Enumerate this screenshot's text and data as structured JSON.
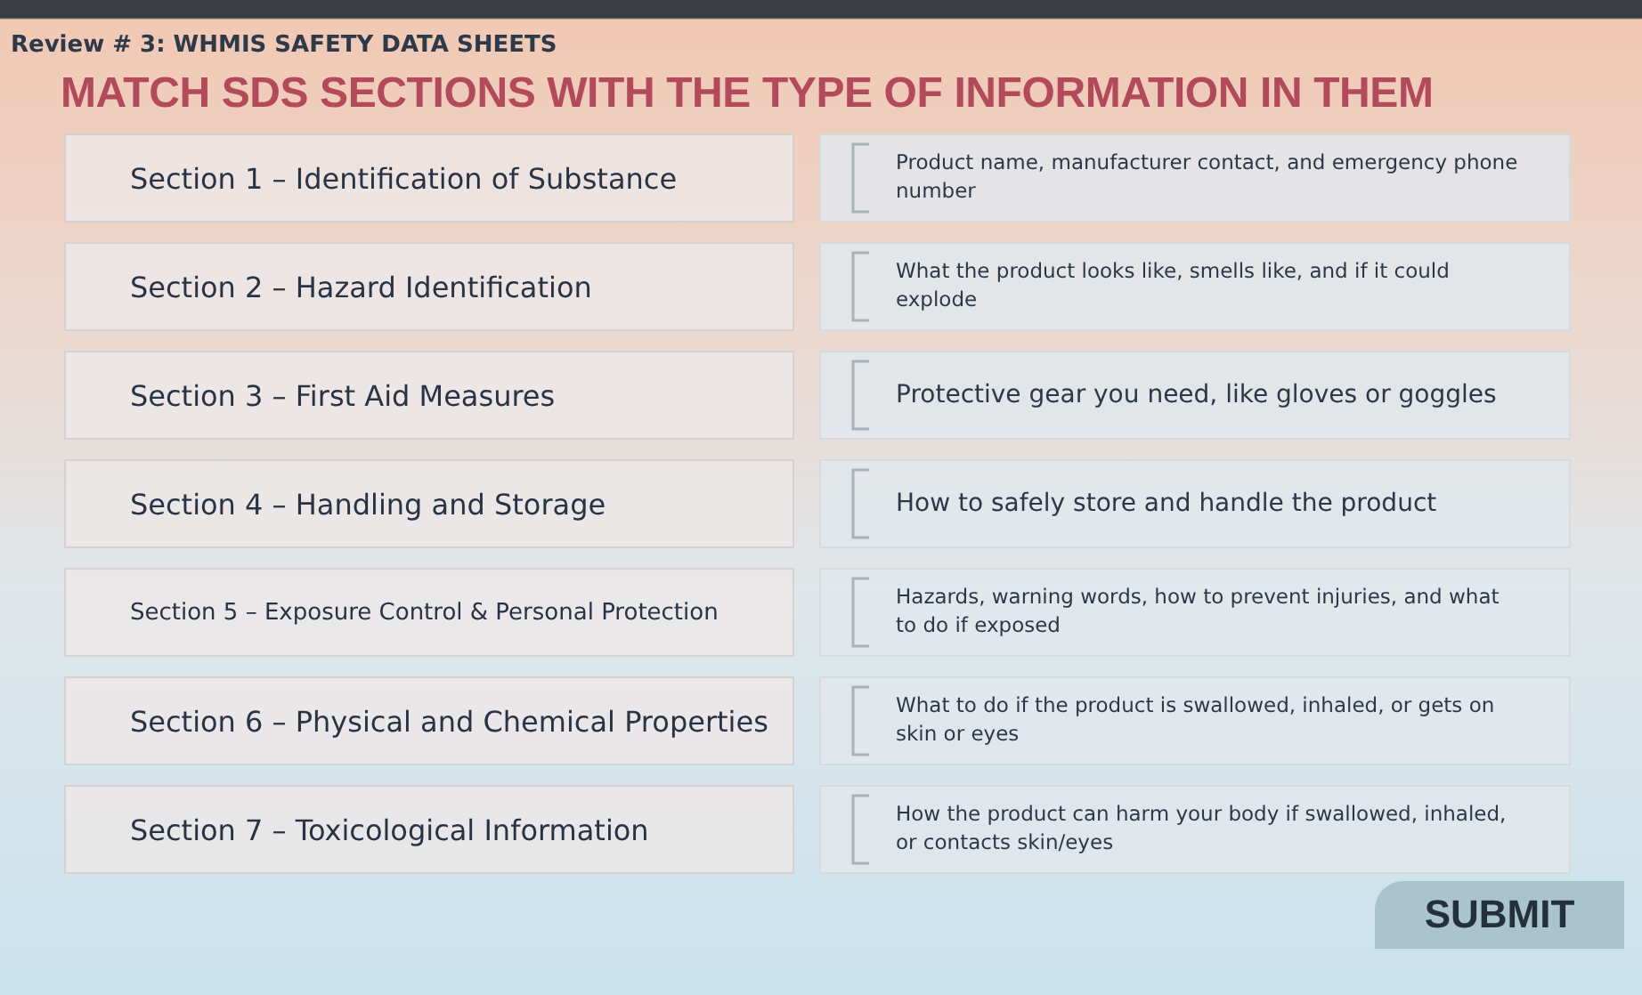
{
  "header": {
    "subtitle": "Review # 3: WHMIS SAFETY DATA SHEETS",
    "title": "MATCH SDS SECTIONS WITH THE TYPE OF INFORMATION IN THEM"
  },
  "rows": [
    {
      "section": "Section 1 – Identification of Substance",
      "info": "Product name, manufacturer contact, and emergency phone number"
    },
    {
      "section": "Section 2 – Hazard Identification",
      "info": "What the product looks like, smells like, and if it could explode"
    },
    {
      "section": "Section 3 – First Aid Measures",
      "info": "Protective gear you need, like gloves or goggles"
    },
    {
      "section": "Section 4 – Handling and Storage",
      "info": "How to safely store and handle the product"
    },
    {
      "section": "Section 5 – Exposure Control & Personal Protection",
      "info": "Hazards, warning words, how to prevent injuries, and what to do if exposed"
    },
    {
      "section": "Section 6 – Physical and Chemical Properties",
      "info": "What to do if the product is swallowed, inhaled, or gets on skin or eyes"
    },
    {
      "section": "Section 7 – Toxicological Information",
      "info": "How the product can harm your body if swallowed, inhaled, or contacts skin/eyes"
    }
  ],
  "submit": "SUBMIT"
}
